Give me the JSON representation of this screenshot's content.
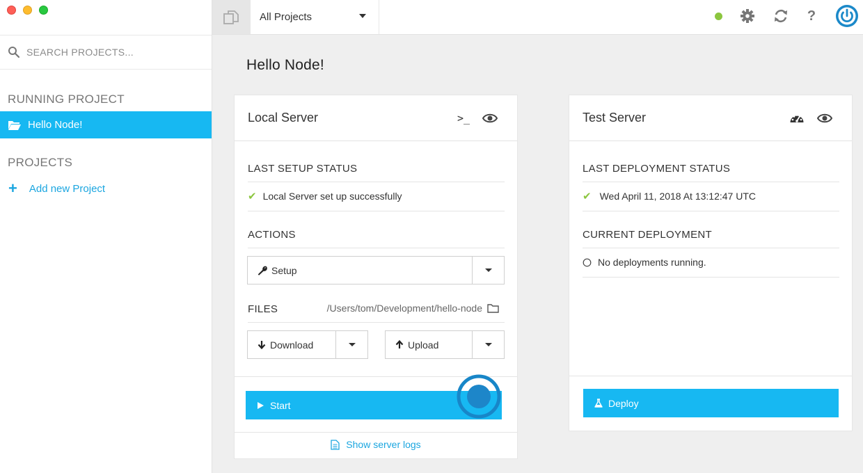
{
  "sidebar": {
    "search_placeholder": "SEARCH PROJECTS...",
    "running_section": "RUNNING PROJECT",
    "running_project": "Hello Node!",
    "projects_section": "PROJECTS",
    "add_project_label": "Add new Project"
  },
  "topbar": {
    "project_selector": "All Projects",
    "status_color": "#8cc63f",
    "help_label": "?"
  },
  "main": {
    "title": "Hello Node!",
    "local": {
      "title": "Local Server",
      "terminal_glyph": ">_",
      "setup_status_title": "LAST SETUP STATUS",
      "setup_status_text": "Local Server set up successfully",
      "actions_title": "ACTIONS",
      "setup_button": "Setup",
      "files_title": "FILES",
      "files_path": "/Users/tom/Development/hello-node",
      "download_button": "Download",
      "upload_button": "Upload",
      "start_button": "Start",
      "logs_link": "Show server logs"
    },
    "test": {
      "title": "Test Server",
      "deploy_status_title": "LAST DEPLOYMENT STATUS",
      "deploy_status_text": "Wed April 11, 2018 At 13:12:47 UTC",
      "current_title": "CURRENT DEPLOYMENT",
      "current_text": "No deployments running.",
      "deploy_button": "Deploy"
    }
  },
  "colors": {
    "accent": "#17b8f2",
    "link": "#1ba6e0",
    "success": "#8cc63f"
  }
}
